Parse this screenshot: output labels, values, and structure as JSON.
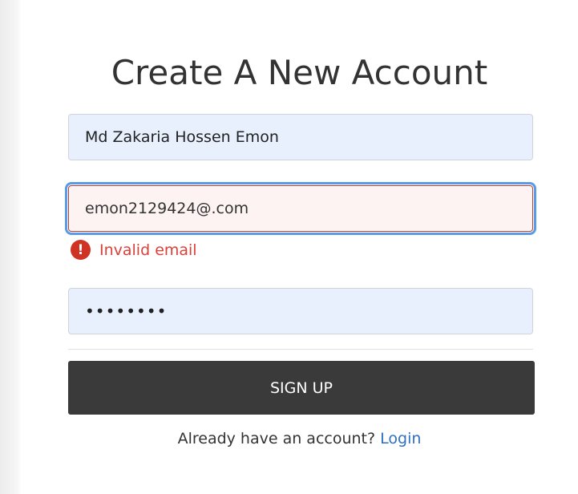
{
  "form": {
    "title": "Create A New Account",
    "name_value": "Md Zakaria Hossen Emon",
    "email_value": "emon2129424@.com",
    "email_error": "Invalid email",
    "error_icon_glyph": "!",
    "password_masked": "••••••••",
    "submit_label": "SIGN UP"
  },
  "footer": {
    "prompt": "Already have an account? ",
    "login_link": "Login"
  },
  "colors": {
    "button_bg": "#3a3a3a",
    "error": "#d9413a",
    "link": "#2f6fc4",
    "focus_ring": "#5a9be6",
    "autofill_bg": "#e8f0fe"
  },
  "icons": {
    "error": "exclamation-circle-icon"
  }
}
